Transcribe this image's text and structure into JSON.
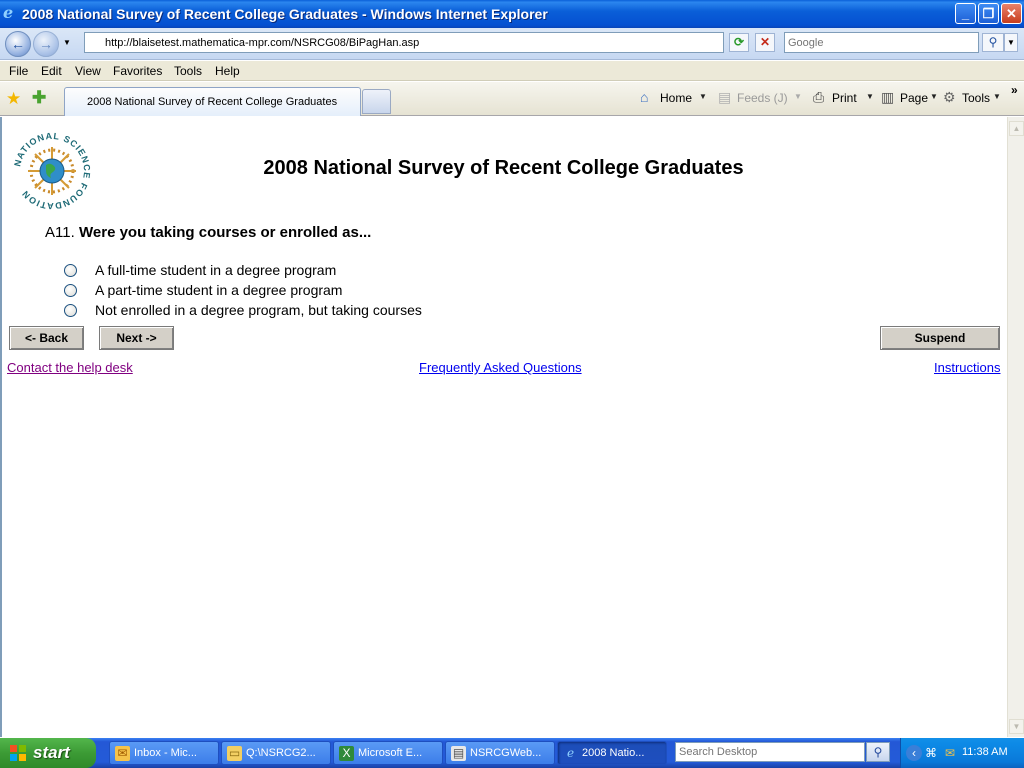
{
  "window": {
    "title": "2008 National Survey of Recent College Graduates - Windows Internet Explorer",
    "minimize_icon": "minimize-icon",
    "maximize_icon": "restore-icon",
    "close_icon": "close-icon"
  },
  "addressbar": {
    "url": "http://blaisetest.mathematica-mpr.com/NSRCG08/BiPagHan.asp",
    "search_placeholder": "Google"
  },
  "menu": [
    "File",
    "Edit",
    "View",
    "Favorites",
    "Tools",
    "Help"
  ],
  "tab": {
    "label": "2008 National Survey of Recent College Graduates"
  },
  "commandbar": {
    "home": "Home",
    "feeds": "Feeds (J)",
    "print": "Print",
    "page": "Page",
    "tools": "Tools"
  },
  "survey": {
    "logo_text": "NATIONAL SCIENCE FOUNDATION",
    "title": "2008 National Survey of Recent College Graduates",
    "question_number": "A11.",
    "question_text": "Were you taking courses or enrolled as...",
    "options": [
      "A full-time student in a degree program",
      "A part-time student in a degree program",
      "Not enrolled in a degree program, but taking courses"
    ],
    "back_label": "<- Back",
    "next_label": "Next ->",
    "suspend_label": "Suspend",
    "link_help": "Contact the help desk",
    "link_faq": "Frequently Asked Questions",
    "link_instructions": "Instructions"
  },
  "taskbar": {
    "start_label": "start",
    "tasks": [
      "Inbox - Mic...",
      "Q:\\NSRCG2...",
      "Microsoft E...",
      "NSRCGWeb...",
      "2008 Natio..."
    ],
    "search_placeholder": "Search Desktop",
    "clock": "11:38 AM"
  },
  "colors": {
    "titlebar": "#0a5fd8",
    "link_visited": "#800080",
    "link": "#0000ee",
    "taskbar": "#245bd8",
    "start": "#3c9b35"
  }
}
